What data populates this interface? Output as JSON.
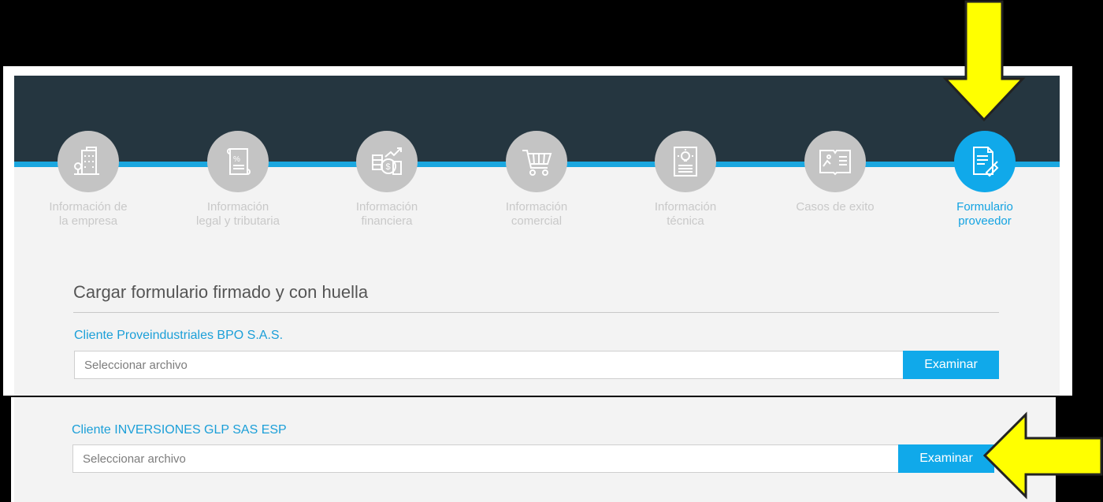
{
  "steps": [
    {
      "label_line1": "Información de",
      "label_line2": "la empresa",
      "icon": "building-icon"
    },
    {
      "label_line1": "Información",
      "label_line2": "legal y tributaria",
      "icon": "document-percent-icon"
    },
    {
      "label_line1": "Información",
      "label_line2": "financiera",
      "icon": "money-chart-icon"
    },
    {
      "label_line1": "Información",
      "label_line2": "comercial",
      "icon": "shopping-cart-icon"
    },
    {
      "label_line1": "Información",
      "label_line2": "técnica",
      "icon": "lightbulb-document-icon"
    },
    {
      "label_line1": "Casos de exito",
      "label_line2": "",
      "icon": "book-image-icon"
    },
    {
      "label_line1": "Formulario",
      "label_line2": "proveedor",
      "icon": "form-signature-icon",
      "active": true
    }
  ],
  "upload": {
    "title": "Cargar formulario firmado y con huella",
    "clients": [
      {
        "label": "Cliente Proveindustriales BPO S.A.S.",
        "placeholder": "Seleccionar archivo",
        "button": "Examinar"
      },
      {
        "label": "Cliente INVERSIONES GLP SAS ESP",
        "placeholder": "Seleccionar archivo",
        "button": "Examinar"
      }
    ]
  },
  "colors": {
    "accent": "#10a9ea",
    "header": "#253640",
    "annotation_arrow": "#ffff00"
  }
}
